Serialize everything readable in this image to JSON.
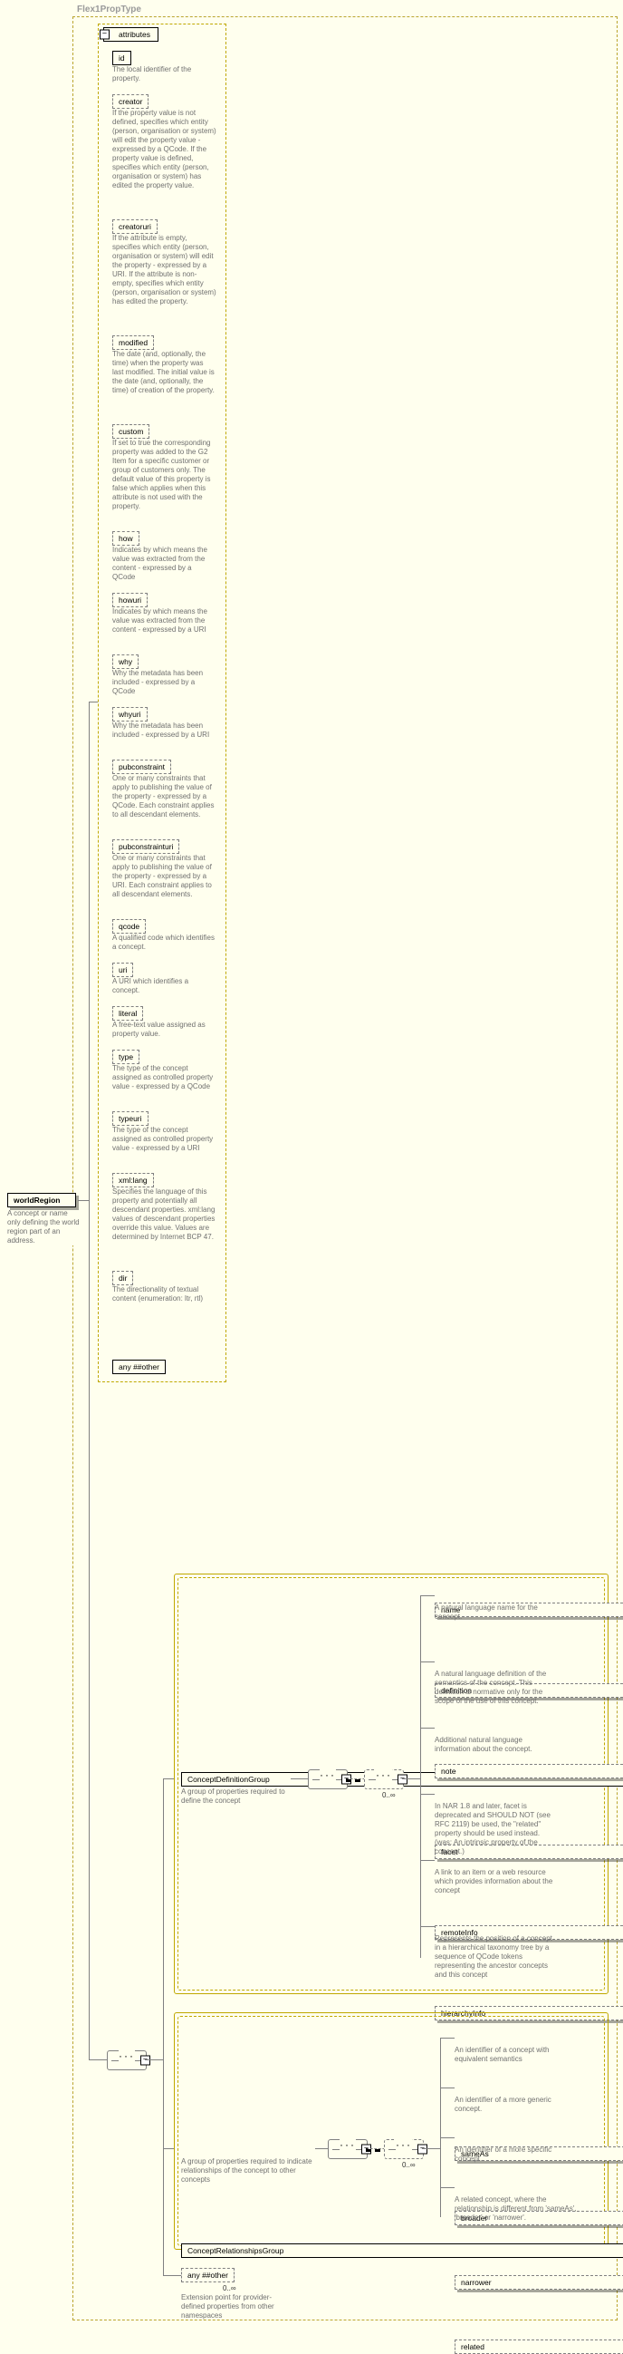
{
  "title": "Flex1PropType",
  "root": {
    "label": "worldRegion",
    "desc": "A concept or name only defining the world region part of an address."
  },
  "attributes_header": "attributes",
  "attrs": [
    {
      "label": "id",
      "style": "solid",
      "desc": "The local identifier of the property."
    },
    {
      "label": "creator",
      "style": "dash",
      "desc": "If the property value is not defined, specifies which entity (person, organisation or system) will edit the property value - expressed by a QCode. If the property value is defined, specifies which entity (person, organisation or system) has edited the property value."
    },
    {
      "label": "creatoruri",
      "style": "dash",
      "desc": "If the attribute is empty, specifies which entity (person, organisation or system) will edit the property - expressed by a URI. If the attribute is non-empty, specifies which entity (person, organisation or system) has edited the property."
    },
    {
      "label": "modified",
      "style": "dash",
      "desc": "The date (and, optionally, the time) when the property was last modified. The initial value is the date (and, optionally, the time) of creation of the property."
    },
    {
      "label": "custom",
      "style": "dash",
      "desc": "If set to true the corresponding property was added to the G2 Item for a specific customer or group of customers only. The default value of this property is false which applies when this attribute is not used with the property."
    },
    {
      "label": "how",
      "style": "dash",
      "desc": "Indicates by which means the value was extracted from the content - expressed by a QCode"
    },
    {
      "label": "howuri",
      "style": "dash",
      "desc": "Indicates by which means the value was extracted from the content - expressed by a URI"
    },
    {
      "label": "why",
      "style": "dash",
      "desc": "Why the metadata has been included - expressed by a QCode"
    },
    {
      "label": "whyuri",
      "style": "dash",
      "desc": "Why the metadata has been included - expressed by a URI"
    },
    {
      "label": "pubconstraint",
      "style": "dash",
      "desc": "One or many constraints that apply to publishing the value of the property - expressed by a QCode. Each constraint applies to all descendant elements."
    },
    {
      "label": "pubconstrainturi",
      "style": "dash",
      "desc": "One or many constraints that apply to publishing the value of the property - expressed by a URI. Each constraint applies to all descendant elements."
    },
    {
      "label": "qcode",
      "style": "dash",
      "desc": "A qualified code which identifies a concept."
    },
    {
      "label": "uri",
      "style": "dash",
      "desc": "A URI which identifies a concept."
    },
    {
      "label": "literal",
      "style": "dash",
      "desc": "A free-text value assigned as property value."
    },
    {
      "label": "type",
      "style": "dash",
      "desc": "The type of the concept assigned as controlled property value - expressed by a QCode"
    },
    {
      "label": "typeuri",
      "style": "dash",
      "desc": "The type of the concept assigned as controlled property value - expressed by a URI"
    },
    {
      "label": "xml:lang",
      "style": "dash",
      "desc": "Specifies the language of this property and potentially all descendant properties. xml:lang values of descendant properties override this value. Values are determined by Internet BCP 47."
    },
    {
      "label": "dir",
      "style": "dash",
      "desc": "The directionality of textual content (enumeration: ltr, rtl)"
    }
  ],
  "attr_any": "any ##other",
  "groups": {
    "def": {
      "label": "ConceptDefinitionGroup",
      "desc": "A group of properties required to define the concept",
      "card": "0..∞"
    },
    "rel": {
      "label": "ConceptRelationshipsGroup",
      "desc": "A group of properties required to indicate relationships of the concept to other concepts",
      "card": "0..∞"
    }
  },
  "def_children": [
    {
      "label": "name",
      "dash": true,
      "desc": "A natural language name for the concept."
    },
    {
      "label": "definition",
      "dash": true,
      "desc": "A natural language definition of the semantics of the concept. This definition is normative only for the scope of the use of this concept."
    },
    {
      "label": "note",
      "dash": true,
      "desc": "Additional natural language information about the concept."
    },
    {
      "label": "facet",
      "dash": true,
      "desc": "In NAR 1.8 and later, facet is deprecated and SHOULD NOT (see RFC 2119) be used, the \"related\" property should be used instead.(was: An intrinsic property of the concept.)"
    },
    {
      "label": "remoteInfo",
      "dash": true,
      "desc": "A link to an item or a web resource which provides information about the concept"
    },
    {
      "label": "hierarchyInfo",
      "dash": true,
      "desc": "Represents the position of a concept in a hierarchical taxonomy tree by a sequence of QCode tokens representing the ancestor concepts and this concept"
    }
  ],
  "rel_children": [
    {
      "label": "sameAs",
      "dash": true,
      "desc": "An identifier of a concept with equivalent semantics"
    },
    {
      "label": "broader",
      "dash": true,
      "desc": "An identifier of a more generic concept."
    },
    {
      "label": "narrower",
      "dash": true,
      "desc": "An identifier of a more specific concept."
    },
    {
      "label": "related",
      "dash": true,
      "desc": "A related concept, where the relationship is different from 'sameAs', 'broader' or 'narrower'."
    }
  ],
  "bottom_any": {
    "label": "any ##other",
    "card": "0..∞",
    "desc": "Extension point for provider-defined properties from other namespaces"
  }
}
